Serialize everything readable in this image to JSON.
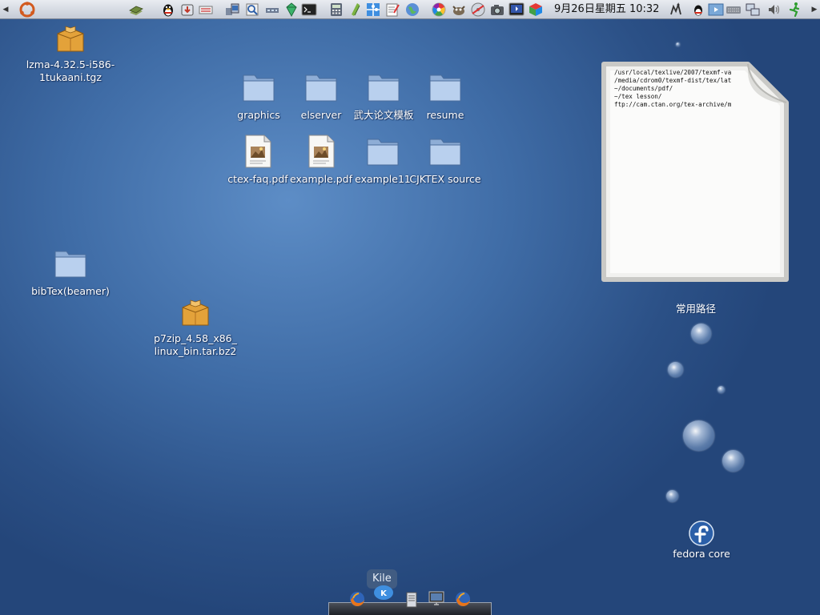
{
  "panel": {
    "clock_text": "9月26日星期五  10:32",
    "launchers": [
      "ubuntu-logo-icon",
      "book-icon",
      "qq-penguin-icon",
      "download-icon",
      "ftp-icon",
      "network-icon",
      "search-icon",
      "hardware-icon",
      "gem-icon",
      "terminal-icon",
      "calculator-icon",
      "sidebar-icon",
      "puzzle-icon",
      "notepad-icon",
      "globe-icon",
      "picasa-icon",
      "gimp-icon",
      "burner-icon",
      "camera-icon",
      "video-icon",
      "cube-icon"
    ],
    "tray": [
      "accessibility-icon",
      "qq-tray-icon",
      "media-icon",
      "keyboard-icon",
      "network-tray-icon",
      "volume-icon",
      "logout-run-icon"
    ]
  },
  "desktop": {
    "icons": [
      {
        "name": "lzma-file",
        "label1": "lzma-4.32.5-i586-",
        "label2": "1tukaani.tgz",
        "kind": "package"
      },
      {
        "name": "graphics-folder",
        "label1": "graphics",
        "kind": "folder"
      },
      {
        "name": "elserver-folder",
        "label1": "elserver",
        "kind": "folder"
      },
      {
        "name": "whu-template-folder",
        "label1": "武大论文模板",
        "kind": "folder"
      },
      {
        "name": "resume-folder",
        "label1": "resume",
        "kind": "folder"
      },
      {
        "name": "ctex-faq-file",
        "label1": "ctex-faq.pdf",
        "kind": "pdf"
      },
      {
        "name": "example-pdf-file",
        "label1": "example.pdf",
        "kind": "pdf"
      },
      {
        "name": "example11-folder",
        "label1": "example11",
        "kind": "folder"
      },
      {
        "name": "cjktex-folder",
        "label1": "CJKTEX source",
        "kind": "folder"
      },
      {
        "name": "bibtex-folder",
        "label1": "bibTex(beamer)",
        "kind": "folder"
      },
      {
        "name": "p7zip-file",
        "label1": "p7zip_4.58_x86_",
        "label2": "linux_bin.tar.bz2",
        "kind": "package"
      },
      {
        "name": "fedora-core-icon",
        "label1": "fedora core",
        "kind": "fedora"
      }
    ]
  },
  "note": {
    "lines": [
      "/usr/local/texlive/2007/texmf-va",
      "/media/cdrom0/texmf-dist/tex/lat",
      "~/documents/pdf/",
      "~/tex lesson/",
      "ftp://cam.ctan.org/tex-archive/m"
    ],
    "label": "常用路径"
  },
  "dock": {
    "tooltip": "Kile",
    "items": [
      "firefox-icon",
      "kile-icon",
      "server-icon",
      "monitor-icon",
      "firefox-icon"
    ]
  },
  "colors": {
    "desktop_bg": "#3f6ca6",
    "panel_bg": "#d6dbe3",
    "folder": "#b4cbe8"
  }
}
